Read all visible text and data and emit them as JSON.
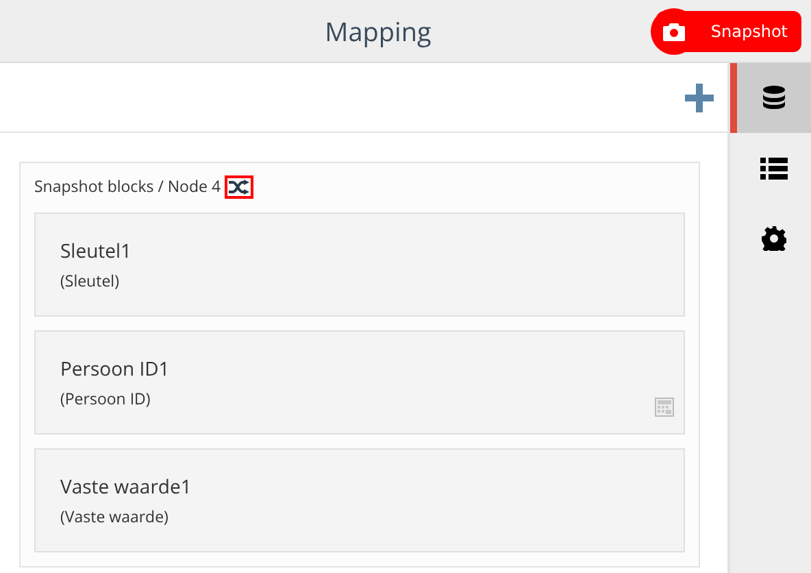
{
  "header": {
    "title": "Mapping",
    "snapshot_button": "Snapshot"
  },
  "sidebar": {
    "items": [
      {
        "kind": "database",
        "selected": true
      },
      {
        "kind": "list",
        "selected": false
      },
      {
        "kind": "settings",
        "selected": false
      }
    ]
  },
  "panel": {
    "breadcrumb": "Snapshot blocks / Node 4",
    "shuffle_highlighted": true,
    "blocks": [
      {
        "name": "Sleutel1",
        "type": "(Sleutel)",
        "calculator": false
      },
      {
        "name": "Persoon ID1",
        "type": "(Persoon ID)",
        "calculator": true
      },
      {
        "name": "Vaste waarde1",
        "type": "(Vaste waarde)",
        "calculator": false
      }
    ]
  }
}
